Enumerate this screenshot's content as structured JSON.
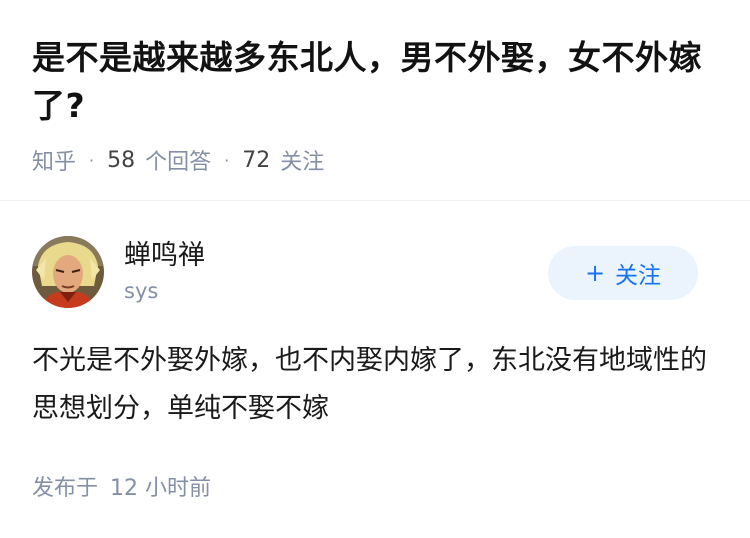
{
  "question": {
    "title": "是不是越来越多东北人，男不外娶，女不外嫁了?",
    "source": "知乎",
    "answers_count": "58",
    "answers_label": "个回答",
    "followers_count": "72",
    "followers_label": "关注"
  },
  "answer": {
    "author_name": "蝉鸣禅",
    "author_subtitle": "sys",
    "follow_label": "关注",
    "follow_icon": "plus-icon",
    "content": "不光是不外娶外嫁，也不内娶内嫁了，东北没有地域性的思想划分，单纯不娶不嫁",
    "published_label": "发布于",
    "published_time": "12 小时前"
  },
  "colors": {
    "meta_gray": "#8590a6",
    "accent_blue": "#1772f6",
    "follow_bg": "#ebf4fc"
  }
}
